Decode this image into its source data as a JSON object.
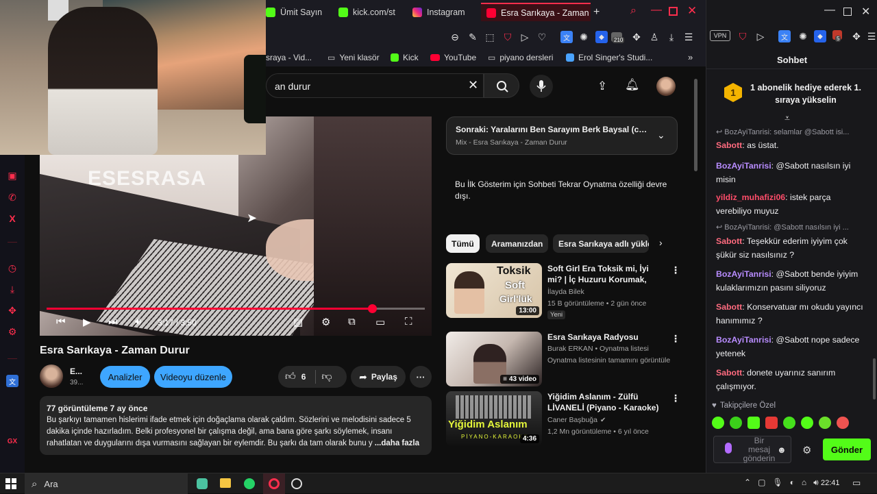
{
  "tabs": [
    {
      "label": "Ümit Sayın"
    },
    {
      "label": "kick.com/st"
    },
    {
      "label": "Instagram"
    },
    {
      "label": "Esra Sarıkaya - Zaman Durur"
    }
  ],
  "kick_window": {
    "chat_title": "Sohbet",
    "pinned_text": "1 abonelik hediye ederek 1. sıraya yükselin",
    "pinned_badge": "1"
  },
  "bookmarks": [
    {
      "label": "sraya - Vid..."
    },
    {
      "label": "Yeni klasör"
    },
    {
      "label": "Kick"
    },
    {
      "label": "YouTube"
    },
    {
      "label": "piyano dersleri"
    },
    {
      "label": "Erol Singer's Studi..."
    }
  ],
  "toolbar_badges": {
    "ext1": "210",
    "ext2": "5"
  },
  "toolbar_labels": {
    "vpn": "VPN"
  },
  "search": {
    "value": "an durur"
  },
  "player": {
    "watermark": "ESESRASA",
    "time": "3:17 / 3:50",
    "progress": 0.86
  },
  "video": {
    "title": "Esra Sarıkaya - Zaman Durur",
    "channel": "E...",
    "subs": "39...",
    "analytics_label": "Analizler",
    "edit_label": "Videoyu düzenle",
    "likes": "6",
    "share_label": "Paylaş"
  },
  "description": {
    "meta": "77 görüntüleme  7 ay önce",
    "text": "Bu şarkıyı tamamen hislerimi ifade etmek için doğaçlama olarak çaldım. Sözlerini ve melodisini sadece 5 dakika içinde hazırladım. Belki profesyonel bir çalışma değil, ama bana göre şarkı söylemek, insanı rahatlatan ve duygularını dışa vurmasını sağlayan bir eylemdir. Bu şarkı da tam olarak bunu y",
    "more": "...daha fazla"
  },
  "upnext": {
    "title": "Sonraki: Yaralarını Ben Sarayım Berk Baysal (cover ...",
    "subtitle": "Mix - Esra Sarıkaya - Zaman Durur"
  },
  "live_chat_notice": "Bu İlk Gösterim için Sohbeti Tekrar Oynatma özelliği devre dışı.",
  "chips": [
    "Tümü",
    "Aramanızdan",
    "Esra Sarıkaya adlı yükleyen"
  ],
  "recommendations": [
    {
      "title": "Soft Girl Era Toksik mi, İyi mi? | İç Huzuru Korumak, Sosyal ...",
      "channel": "İlayda Bilek",
      "meta": "15 B görüntüleme • 2 gün önce",
      "badge": "Yeni",
      "duration": "13:00",
      "thumb_text": [
        "Toksik",
        "Soft",
        "Girl'lük"
      ]
    },
    {
      "title": "Esra Sarıkaya Radyosu",
      "channel": "Burak ERKAN • Oynatma listesi",
      "meta": "Oynatma listesinin tamamını görüntüle",
      "badge": "",
      "duration": "43 video",
      "thumb_text": []
    },
    {
      "title": "Yiğidim Aslanım - Zülfü LİVANELİ (Piyano - Karaoke) ...",
      "channel": "Caner Başbuğa",
      "meta": "1,2 Mn görüntüleme • 6 yıl önce",
      "badge": "",
      "duration": "4:36",
      "thumb_text": [
        "Yiğidim Aslanım",
        "PİYANO-KARAOKE"
      ]
    }
  ],
  "chat": [
    {
      "type": "reply",
      "text": "BozAyiTanrisi: selamlar @Sabott isi..."
    },
    {
      "type": "msg",
      "user": "Sabott",
      "color": "#ff6b7f",
      "text": "as üstat."
    },
    {
      "type": "msg",
      "user": "BozAyiTanrisi",
      "color": "#b88cff",
      "text": "@Sabott nasılsın iyi misin"
    },
    {
      "type": "msg",
      "user": "yildiz_muhafizi06",
      "color": "#ff4d6a",
      "text": "istek parça verebiliyo muyuz"
    },
    {
      "type": "reply",
      "text": "BozAyiTanrisi: @Sabott nasılsın iyi ..."
    },
    {
      "type": "msg",
      "user": "Sabott",
      "color": "#ff6b7f",
      "text": "Teşekkür ederim iyiyim çok şükür siz nasılsınız ?"
    },
    {
      "type": "msg",
      "user": "BozAyiTanrisi",
      "color": "#b88cff",
      "text": "@Sabott bende iyiyim kulaklarımızın pasını siliyoruz"
    },
    {
      "type": "msg",
      "user": "Sabott",
      "color": "#ff6b7f",
      "text": "Konservatuar mı okudu yayıncı hanımımız ?"
    },
    {
      "type": "msg",
      "user": "BozAyiTanrisi",
      "color": "#b88cff",
      "text": "@Sabott nope sadece yetenek"
    },
    {
      "type": "msg",
      "user": "Sabott",
      "color": "#ff6b7f",
      "text": "donete uyarınız sanırım çalışmıyor."
    }
  ],
  "followers_only": "Takipçilere Özel",
  "chat_input": {
    "placeholder": "Bir mesaj gönderin",
    "send_label": "Gönder"
  },
  "taskbar": {
    "search_label": "Ara",
    "clock": "22:41"
  },
  "colors": {
    "accent_red": "#ff0033",
    "kick_green": "#53fc18",
    "yt_blue": "#3ea6ff",
    "opera_red": "#ff2e4d"
  }
}
